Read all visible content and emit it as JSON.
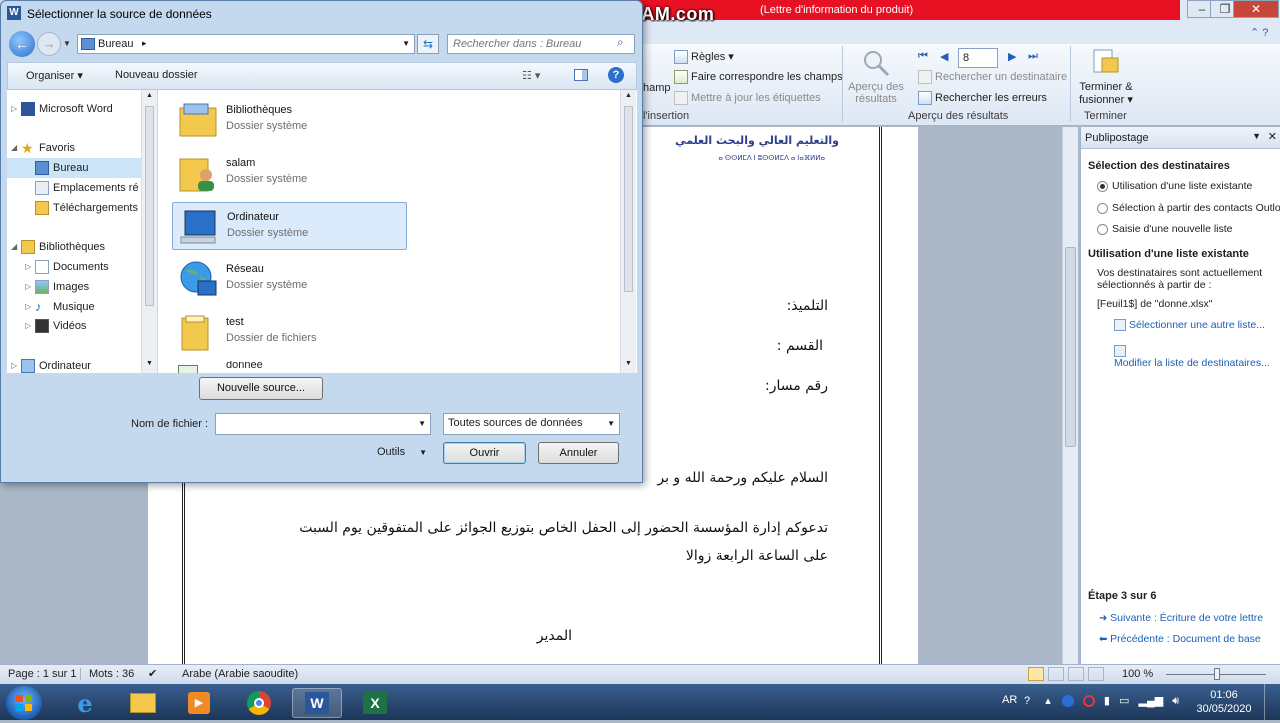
{
  "word": {
    "title_fragment": "(Lettre d'information du produit)",
    "watermark": "www.BANDICAM.com",
    "ribbon": {
      "regles": "Règles",
      "faire_correspondre": "Faire correspondre les champs",
      "mettre_a_jour": "Mettre à jour les étiquettes",
      "champ_fragment": "hamp",
      "insertion_group": "l'insertion",
      "apercu_resultats": [
        "Aperçu des",
        "résultats"
      ],
      "record_number": "8",
      "rechercher_destinataire": "Rechercher un destinataire",
      "rechercher_erreurs": "Rechercher les erreurs",
      "apercu_group": "Aperçu des résultats",
      "terminer_fusionner": [
        "Terminer &",
        "fusionner"
      ],
      "terminer_group": "Terminer"
    },
    "document": {
      "header_line1": "والتعليم العالي والبحث العلمي",
      "header_tifinagh": "ⴰ ⵙⵙⵍⵎⴷ ⵏ ⵓⵙⵙⵍⵎⴷ ⴰ ⵏⴰⴼⵍⵍⴰ",
      "field_student": "التلميذ:",
      "field_class": "القسم :",
      "field_massar": "رقم مسار:",
      "greeting": "السلام عليكم ورحمة الله و بر",
      "invitation": "تدعوكم إدارة المؤسسة الحضور إلى الحفل الخاص بتوزيع الجوائز على المتفوقين يوم السبت",
      "time": "على الساعة الرابعة زوالا",
      "signature": "المدير"
    },
    "pane": {
      "title": "Publipostage",
      "sec_recipients": "Sélection des destinataires",
      "opt_existing": "Utilisation d'une liste existante",
      "opt_outlook": "Sélection à partir des contacts Outlook",
      "opt_new": "Saisie d'une nouvelle liste",
      "sec_using": "Utilisation d'une liste existante",
      "desc": [
        "Vos destinataires sont actuellement",
        "sélectionnés à partir de :"
      ],
      "source": "[Feuil1$] de \"donne.xlsx\"",
      "link_other": "Sélectionner une autre liste...",
      "link_modify": "Modifier la liste de destinataires...",
      "step": "Étape 3 sur 6",
      "next": "Suivante : Écriture de votre lettre",
      "prev": "Précédente : Document de base"
    },
    "status": {
      "page": "Page : 1 sur 1",
      "words": "Mots : 36",
      "language": "Arabe (Arabie saoudite)",
      "zoom": "100 %"
    }
  },
  "dialog": {
    "title": "Sélectionner la source de données",
    "address": "Bureau",
    "search_placeholder": "Rechercher dans : Bureau",
    "organiser": "Organiser",
    "nouveau_dossier": "Nouveau dossier",
    "nav": [
      {
        "label": "Microsoft Word"
      },
      {
        "label": "Favoris"
      },
      {
        "label": "Bureau"
      },
      {
        "label": "Emplacements ré"
      },
      {
        "label": "Téléchargements"
      },
      {
        "label": "Bibliothèques"
      },
      {
        "label": "Documents"
      },
      {
        "label": "Images"
      },
      {
        "label": "Musique"
      },
      {
        "label": "Vidéos"
      },
      {
        "label": "Ordinateur"
      }
    ],
    "files": [
      {
        "name": "Bibliothèques",
        "type": "Dossier système"
      },
      {
        "name": "salam",
        "type": "Dossier système"
      },
      {
        "name": "Ordinateur",
        "type": "Dossier système"
      },
      {
        "name": "Réseau",
        "type": "Dossier système"
      },
      {
        "name": "test",
        "type": "Dossier de fichiers"
      },
      {
        "name": "donnee",
        "type": ""
      }
    ],
    "nouvelle_source": "Nouvelle source...",
    "nom_fichier_label": "Nom de fichier :",
    "filter": "Toutes sources de données",
    "outils": "Outils",
    "ouvrir": "Ouvrir",
    "annuler": "Annuler"
  },
  "taskbar": {
    "lang": "AR",
    "time": "01:06",
    "date": "30/05/2020"
  }
}
